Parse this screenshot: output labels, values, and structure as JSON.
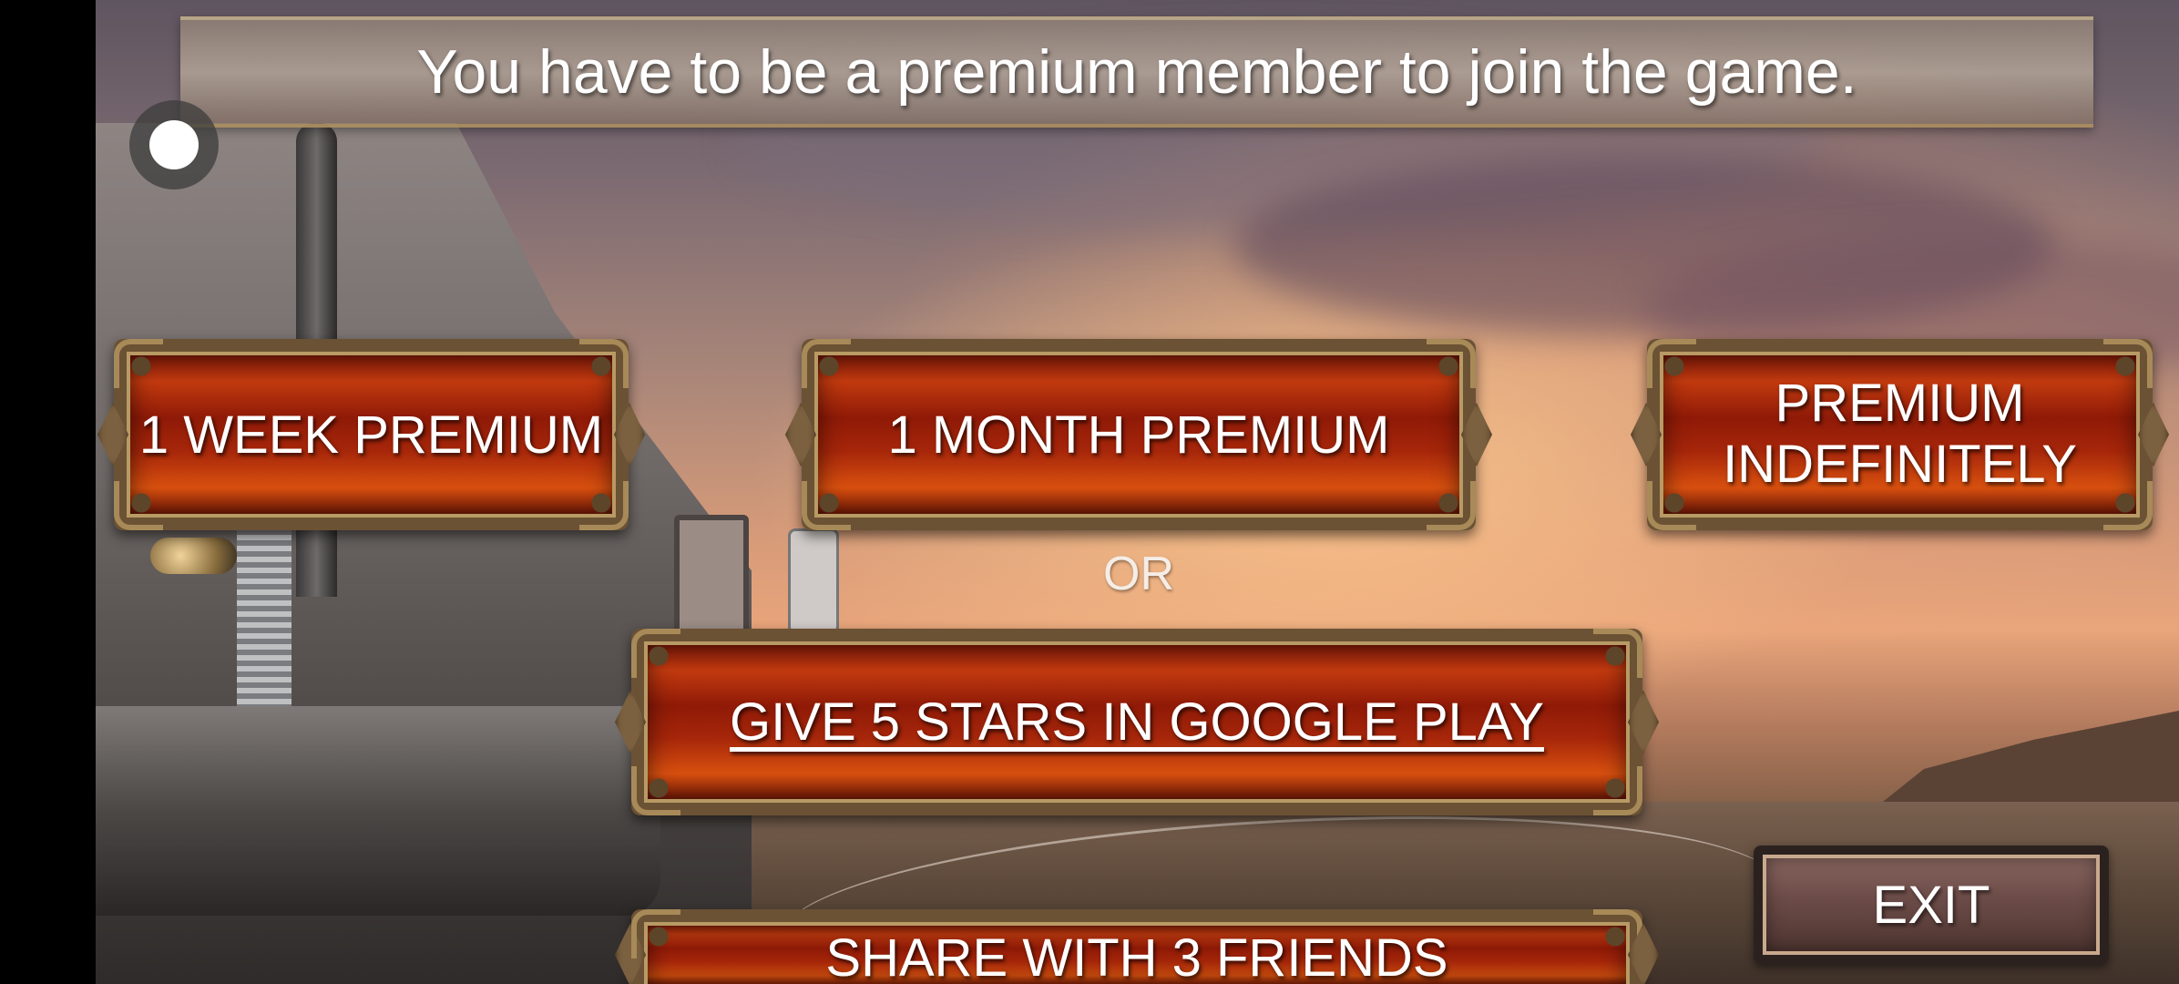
{
  "header": {
    "message": "You have to be a premium member to join the game."
  },
  "premium_options": [
    {
      "label": "1 WEEK PREMIUM"
    },
    {
      "label": "1 MONTH PREMIUM"
    },
    {
      "label_line1": "PREMIUM",
      "label_line2": "INDEFINITELY"
    }
  ],
  "separator": "OR",
  "free_options": {
    "rate_label": "GIVE 5 STARS IN GOOGLE PLAY",
    "share_label": "SHARE WITH 3 FRIENDS"
  },
  "exit_label": "EXIT",
  "icons": {
    "record": "record-icon"
  },
  "colors": {
    "button_red": "#c23a0f",
    "frame_bronze": "#6b5234",
    "exit_brown": "#6b4b47"
  }
}
